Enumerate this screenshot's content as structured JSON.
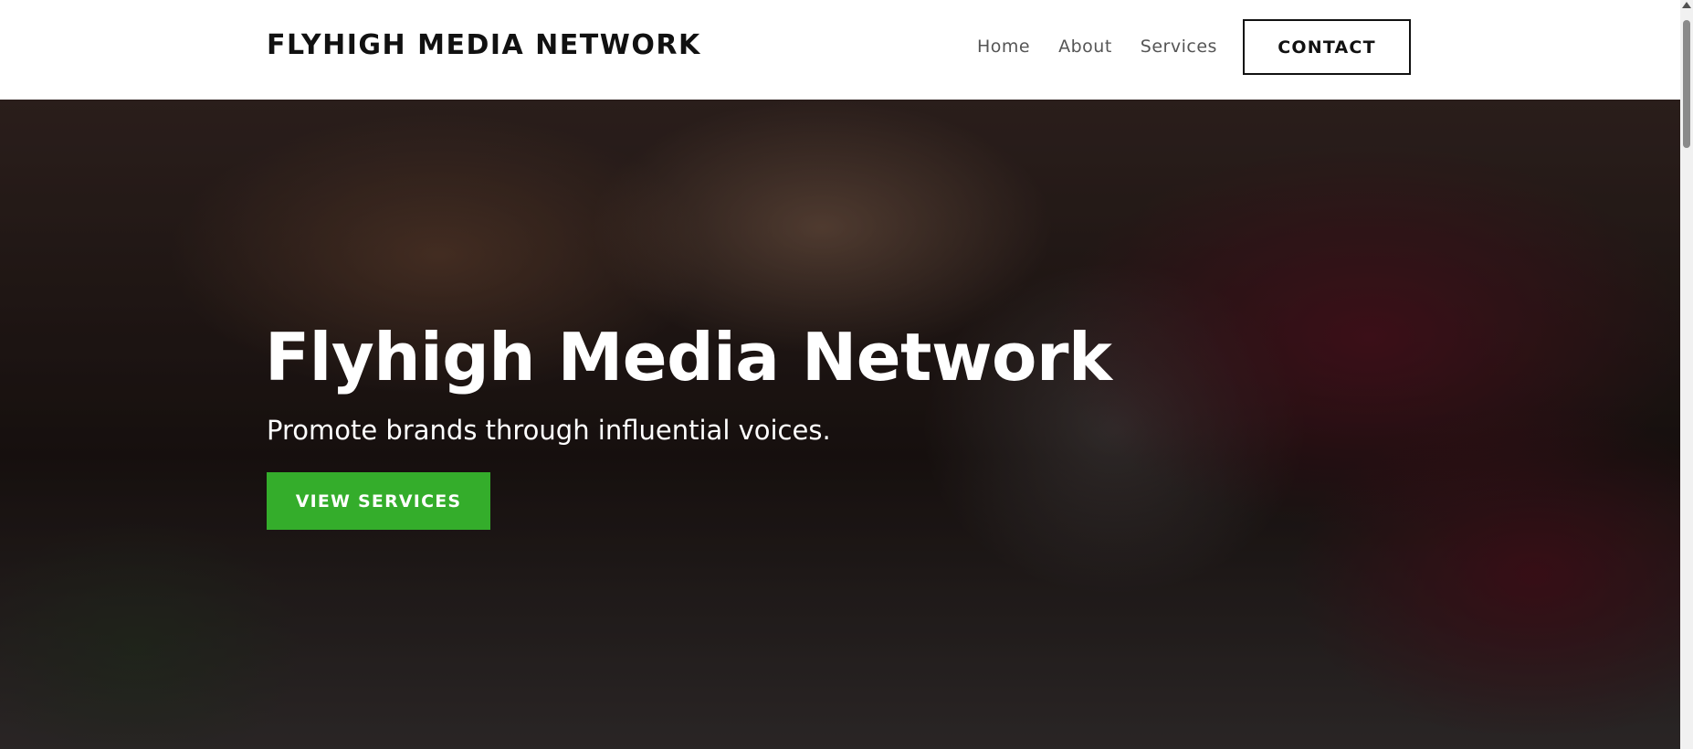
{
  "header": {
    "brand": "FLYHIGH MEDIA NETWORK",
    "nav": [
      {
        "label": "Home"
      },
      {
        "label": "About"
      },
      {
        "label": "Services"
      }
    ],
    "contact_label": "CONTACT"
  },
  "hero": {
    "title": "Flyhigh Media Network",
    "subtitle": "Promote brands through influential voices.",
    "cta_label": "VIEW SERVICES",
    "image": "team-fist-bump-photo"
  },
  "colors": {
    "accent": "#34ad2b",
    "text_dark": "#111111",
    "nav_text": "#555555",
    "header_bg": "#ffffff"
  },
  "scrollbar": {
    "icon_up": "chevron-up-icon"
  }
}
